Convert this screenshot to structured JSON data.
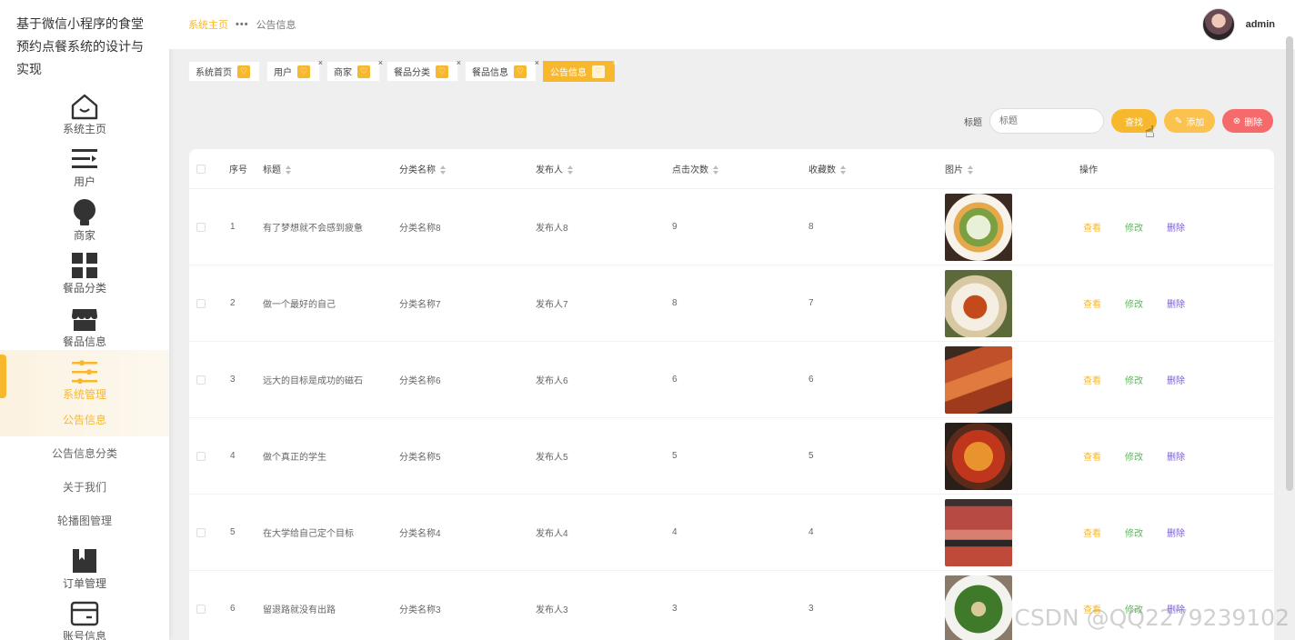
{
  "sidebar": {
    "app_title": "基于微信小程序的食堂预约点餐系统的设计与实现",
    "items": [
      {
        "label": "系统主页",
        "icon": "home-icon"
      },
      {
        "label": "用户",
        "icon": "user-list-icon"
      },
      {
        "label": "商家",
        "icon": "lightbulb-icon"
      },
      {
        "label": "餐品分类",
        "icon": "grid-icon"
      },
      {
        "label": "餐品信息",
        "icon": "shop-icon"
      },
      {
        "label": "系统管理",
        "icon": "sliders-icon"
      }
    ],
    "sub_items": [
      {
        "label": "公告信息"
      },
      {
        "label": "公告信息分类"
      },
      {
        "label": "关于我们"
      },
      {
        "label": "轮播图管理"
      }
    ],
    "more_items": [
      {
        "label": "订单管理",
        "icon": "bookmark-icon"
      },
      {
        "label": "账号信息",
        "icon": "wallet-icon"
      }
    ]
  },
  "header": {
    "breadcrumb_home": "系统主页",
    "breadcrumb_sep": "•••",
    "breadcrumb_current": "公告信息",
    "username": "admin"
  },
  "tags": [
    {
      "label": "系统首页"
    },
    {
      "label": "用户",
      "close": "×"
    },
    {
      "label": "商家",
      "close": "×"
    },
    {
      "label": "餐品分类",
      "close": "×"
    },
    {
      "label": "餐品信息",
      "close": "×"
    },
    {
      "label": "公告信息",
      "close": "×"
    }
  ],
  "search": {
    "label": "标题",
    "placeholder": "标题",
    "search_btn": "查找",
    "add_btn": "添加",
    "delete_btn": "删除"
  },
  "table": {
    "headers": [
      "序号",
      "标题",
      "分类名称",
      "发布人",
      "点击次数",
      "收藏数",
      "图片",
      "操作"
    ],
    "rows": [
      {
        "no": "1",
        "title": "有了梦想就不会感到疲惫",
        "category": "分类名称8",
        "publisher": "发布人8",
        "clicks": "9",
        "favorites": "8"
      },
      {
        "no": "2",
        "title": "做一个最好的自己",
        "category": "分类名称7",
        "publisher": "发布人7",
        "clicks": "8",
        "favorites": "7"
      },
      {
        "no": "3",
        "title": "远大的目标是成功的磁石",
        "category": "分类名称6",
        "publisher": "发布人6",
        "clicks": "6",
        "favorites": "6"
      },
      {
        "no": "4",
        "title": "做个真正的学生",
        "category": "分类名称5",
        "publisher": "发布人5",
        "clicks": "5",
        "favorites": "5"
      },
      {
        "no": "5",
        "title": "在大学给自己定个目标",
        "category": "分类名称4",
        "publisher": "发布人4",
        "clicks": "4",
        "favorites": "4"
      },
      {
        "no": "6",
        "title": "留退路就没有出路",
        "category": "分类名称3",
        "publisher": "发布人3",
        "clicks": "3",
        "favorites": "3"
      }
    ],
    "actions": {
      "view": "查看",
      "edit": "修改",
      "delete": "删除"
    }
  },
  "watermark": "CSDN @QQ2279239102",
  "colors": {
    "accent": "#f7b82e",
    "danger": "#f56a6a",
    "edit": "#5cb85c",
    "delete_link": "#7b5cd6"
  }
}
